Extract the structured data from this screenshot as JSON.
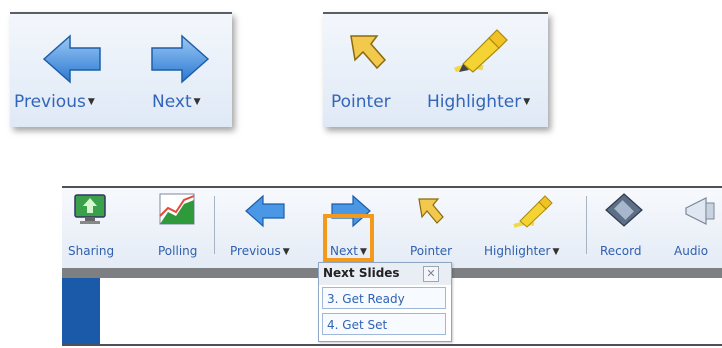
{
  "panel_nav": {
    "previous_label": "Previous",
    "next_label": "Next"
  },
  "panel_tools": {
    "pointer_label": "Pointer",
    "highlighter_label": "Highlighter"
  },
  "toolbar": {
    "items": [
      {
        "label": "Sharing"
      },
      {
        "label": "Polling"
      },
      {
        "label": "Previous"
      },
      {
        "label": "Next"
      },
      {
        "label": "Pointer"
      },
      {
        "label": "Highlighter"
      },
      {
        "label": "Record"
      },
      {
        "label": "Audio"
      }
    ]
  },
  "next_slides": {
    "title": "Next Slides",
    "close_glyph": "✕",
    "items": [
      "3. Get Ready",
      "4. Get Set"
    ]
  },
  "icons": {
    "arrow_color": "#3d8ee0",
    "highlight_border": "#f39a1d",
    "accent_blue": "#3366b8"
  }
}
